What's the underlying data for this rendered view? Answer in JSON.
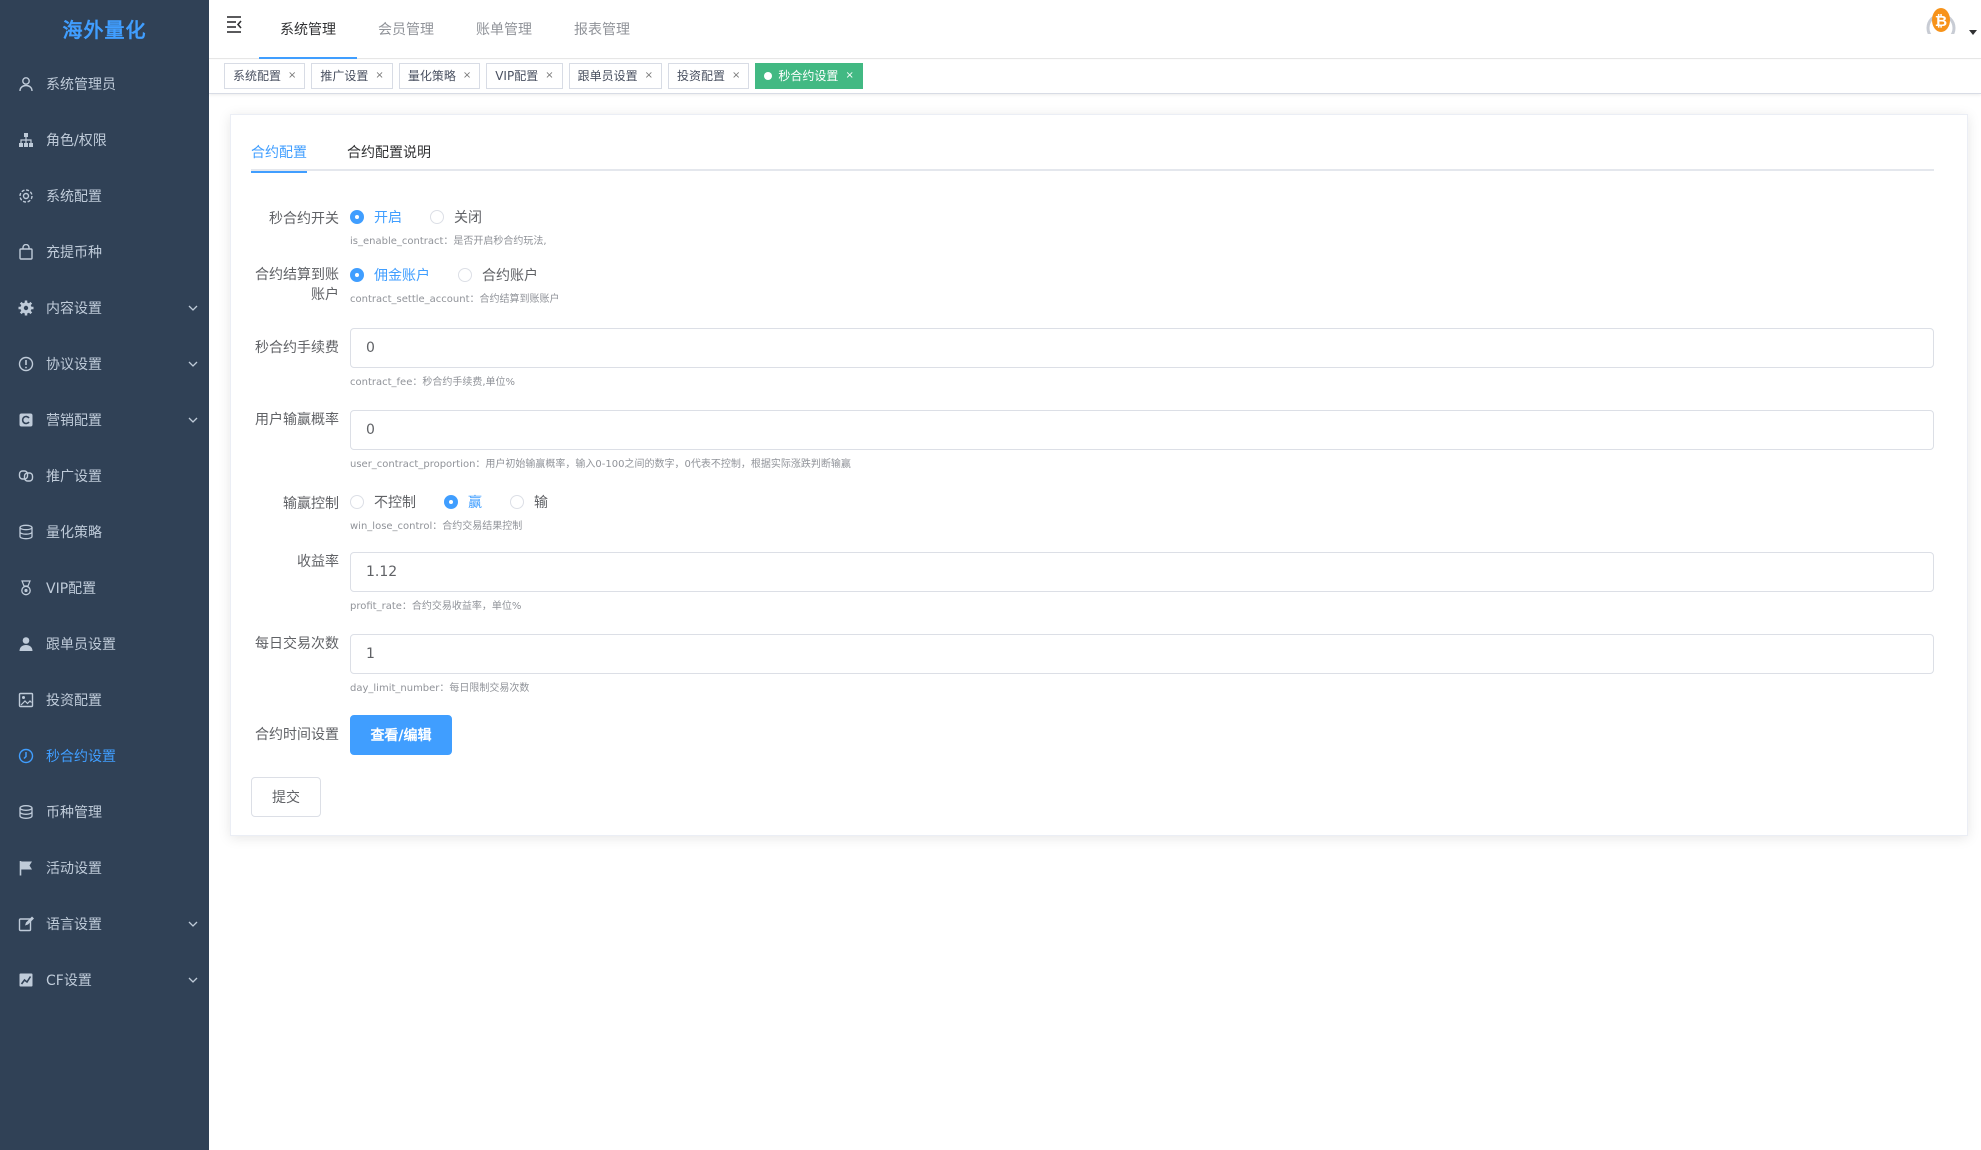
{
  "sidebar": {
    "logo": "海外量化",
    "items": [
      {
        "label": "系统管理员",
        "icon": "user-icon"
      },
      {
        "label": "角色/权限",
        "icon": "sitemap-icon"
      },
      {
        "label": "系统配置",
        "icon": "gear-icon"
      },
      {
        "label": "充提币种",
        "icon": "bag-icon"
      },
      {
        "label": "内容设置",
        "icon": "cog-icon",
        "has_arrow": true
      },
      {
        "label": "协议设置",
        "icon": "info-icon",
        "has_arrow": true
      },
      {
        "label": "营销配置",
        "icon": "marketing-icon",
        "has_arrow": true
      },
      {
        "label": "推广设置",
        "icon": "link-icon"
      },
      {
        "label": "量化策略",
        "icon": "database-icon"
      },
      {
        "label": "VIP配置",
        "icon": "medal-icon"
      },
      {
        "label": "跟单员设置",
        "icon": "person-icon"
      },
      {
        "label": "投资配置",
        "icon": "image-icon"
      },
      {
        "label": "秒合约设置",
        "icon": "clock-icon",
        "active": true
      },
      {
        "label": "币种管理",
        "icon": "coins-icon"
      },
      {
        "label": "活动设置",
        "icon": "flag-icon"
      },
      {
        "label": "语言设置",
        "icon": "edit-icon",
        "has_arrow": true
      },
      {
        "label": "CF设置",
        "icon": "chart-icon",
        "has_arrow": true
      }
    ]
  },
  "navbar": {
    "tabs": [
      {
        "label": "系统管理",
        "active": true
      },
      {
        "label": "会员管理"
      },
      {
        "label": "账单管理"
      },
      {
        "label": "报表管理"
      }
    ]
  },
  "tags": [
    {
      "label": "系统配置"
    },
    {
      "label": "推广设置"
    },
    {
      "label": "量化策略"
    },
    {
      "label": "VIP配置"
    },
    {
      "label": "跟单员设置"
    },
    {
      "label": "投资配置"
    },
    {
      "label": "秒合约设置",
      "active": true
    }
  ],
  "form_tabs": [
    {
      "label": "合约配置",
      "active": true
    },
    {
      "label": "合约配置说明"
    }
  ],
  "form": {
    "enable_contract": {
      "label": "秒合约开关",
      "options": [
        "开启",
        "关闭"
      ],
      "selected": "开启",
      "hint": "is_enable_contract：是否开启秒合约玩法,"
    },
    "settle_account": {
      "label_line1": "合约结算到账",
      "label_line2": "账户",
      "options": [
        "佣金账户",
        "合约账户"
      ],
      "selected": "佣金账户",
      "hint": "contract_settle_account：合约结算到账账户"
    },
    "fee": {
      "label": "秒合约手续费",
      "value": "0",
      "hint": "contract_fee：秒合约手续费,单位%"
    },
    "proportion": {
      "label": "用户输赢概率",
      "value": "0",
      "hint": "user_contract_proportion：用户初始输赢概率，输入0-100之间的数字，0代表不控制，根据实际涨跌判断输赢"
    },
    "win_lose": {
      "label": "输赢控制",
      "options": [
        "不控制",
        "赢",
        "输"
      ],
      "selected": "赢",
      "hint": "win_lose_control：合约交易结果控制"
    },
    "profit_rate": {
      "label": "收益率",
      "value": "1.12",
      "hint": "profit_rate：合约交易收益率，单位%"
    },
    "day_limit": {
      "label": "每日交易次数",
      "value": "1",
      "hint": "day_limit_number：每日限制交易次数"
    },
    "time_setting": {
      "label": "合约时间设置",
      "button": "查看/编辑"
    },
    "submit": "提交"
  },
  "colors": {
    "sidebar_bg": "#304156",
    "primary": "#409eff",
    "active_tag": "#42b983"
  }
}
